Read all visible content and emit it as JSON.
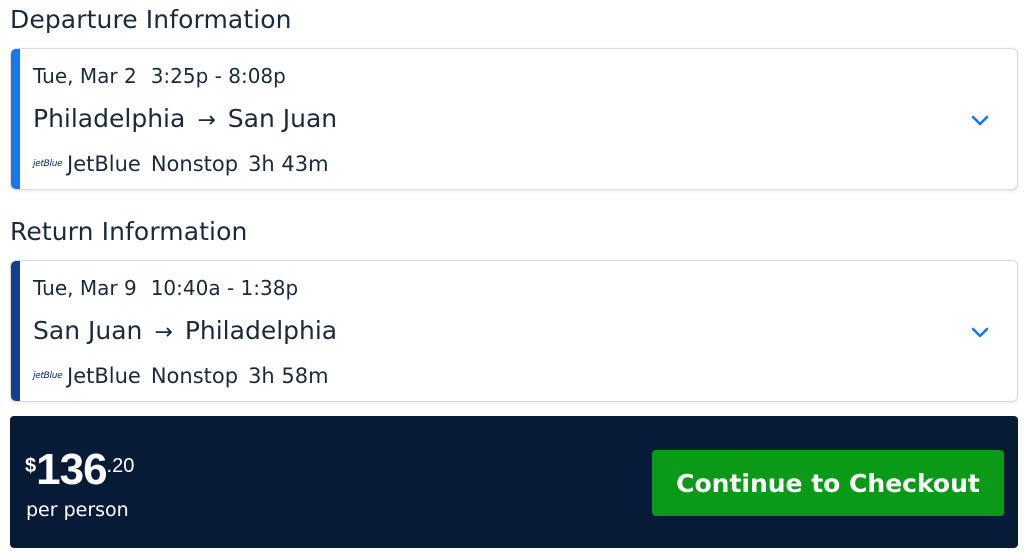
{
  "departure": {
    "heading": "Departure Information",
    "date": "Tue, Mar 2",
    "times": "3:25p - 8:08p",
    "origin": "Philadelphia",
    "arrow": "→",
    "destination": "San Juan",
    "airline_logo": "jetBlue",
    "airline": "JetBlue",
    "stops": "Nonstop",
    "duration": "3h 43m",
    "expand_icon": "chevron-down-icon"
  },
  "return": {
    "heading": "Return Information",
    "date": "Tue, Mar 9",
    "times": "10:40a - 1:38p",
    "origin": "San Juan",
    "arrow": "→",
    "destination": "Philadelphia",
    "airline_logo": "jetBlue",
    "airline": "JetBlue",
    "stops": "Nonstop",
    "duration": "3h 58m",
    "expand_icon": "chevron-down-icon"
  },
  "checkout": {
    "currency": "$",
    "price_whole": "136",
    "price_cents": ".20",
    "per_person": "per person",
    "button_label": "Continue to Checkout"
  },
  "colors": {
    "departure_accent": "#1478f0",
    "return_accent": "#0f3f8f",
    "checkout_bg": "#071a36",
    "button_green": "#0b9a17",
    "chevron": "#1478f0"
  }
}
